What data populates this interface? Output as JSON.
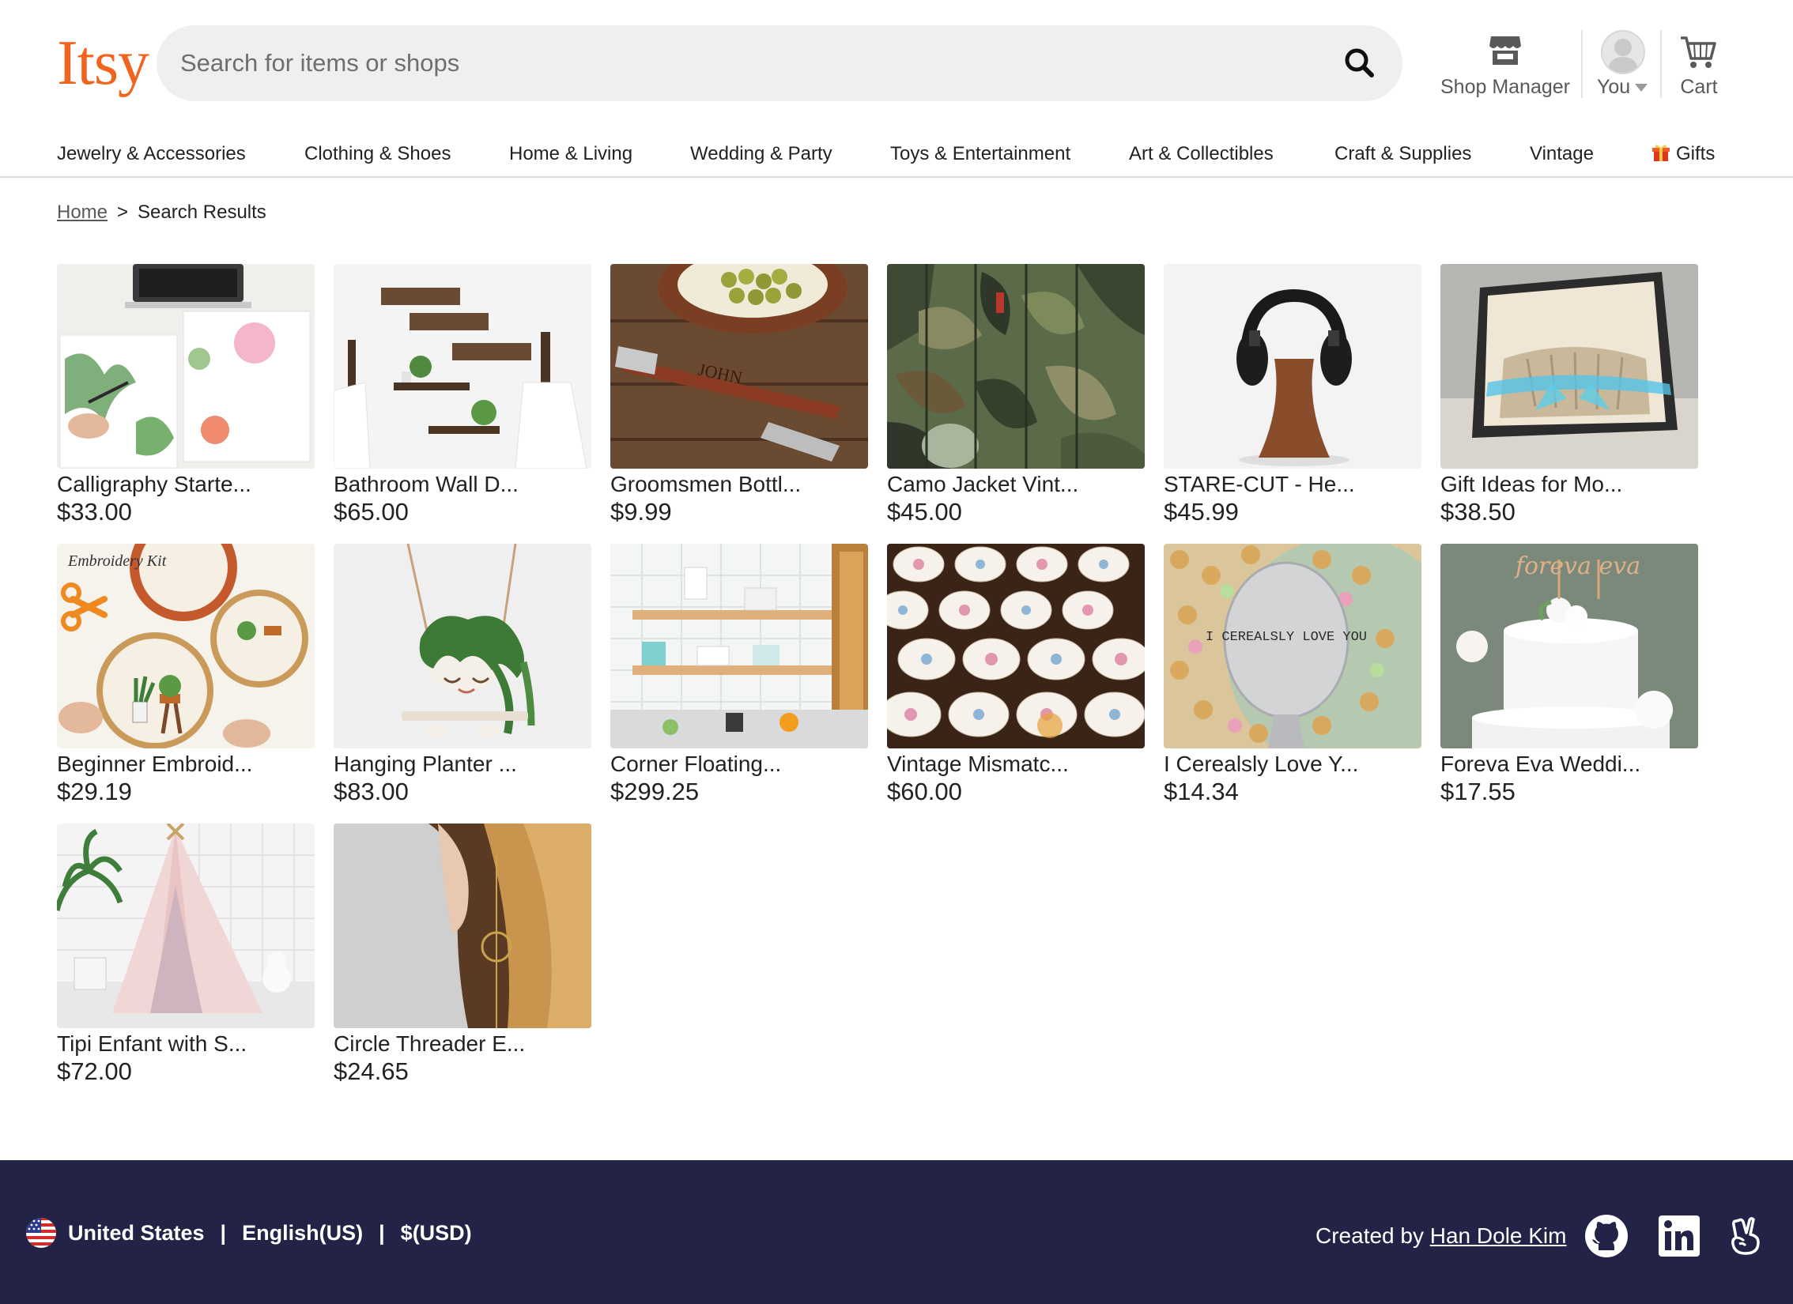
{
  "header": {
    "logo": "Itsy",
    "search_placeholder": "Search for items or shops",
    "shop_manager_label": "Shop Manager",
    "you_label": "You",
    "cart_label": "Cart"
  },
  "categories": [
    {
      "label": "Jewelry & Accessories"
    },
    {
      "label": "Clothing & Shoes"
    },
    {
      "label": "Home & Living"
    },
    {
      "label": "Wedding & Party"
    },
    {
      "label": "Toys & Entertainment"
    },
    {
      "label": "Art & Collectibles"
    },
    {
      "label": "Craft & Supplies"
    },
    {
      "label": "Vintage"
    },
    {
      "label": "Gifts",
      "icon": "gift-icon"
    }
  ],
  "breadcrumb": {
    "home": "Home",
    "separator": ">",
    "current": "Search Results"
  },
  "products": [
    {
      "title": "Calligraphy Starte...",
      "price": "$33.00",
      "image": "calligraphy-kit-image"
    },
    {
      "title": "Bathroom Wall D...",
      "price": "$65.00",
      "image": "bathroom-shelves-image"
    },
    {
      "title": "Groomsmen Bottl...",
      "price": "$9.99",
      "image": "bottle-opener-image"
    },
    {
      "title": "Camo Jacket Vint...",
      "price": "$45.00",
      "image": "camo-jackets-image"
    },
    {
      "title": "STARE-CUT - He...",
      "price": "$45.99",
      "image": "headphone-stand-image"
    },
    {
      "title": "Gift Ideas for Mo...",
      "price": "$38.50",
      "image": "folded-book-image"
    },
    {
      "title": "Beginner Embroid...",
      "price": "$29.19",
      "image": "embroidery-kit-image"
    },
    {
      "title": "Hanging Planter ...",
      "price": "$83.00",
      "image": "hanging-planter-image"
    },
    {
      "title": "Corner Floating...",
      "price": "$299.25",
      "image": "floating-shelves-image"
    },
    {
      "title": "Vintage Mismatc...",
      "price": "$60.00",
      "image": "teacups-image"
    },
    {
      "title": "I Cerealsly Love Y...",
      "price": "$14.34",
      "image": "stamped-spoon-image"
    },
    {
      "title": "Foreva Eva Weddi...",
      "price": "$17.55",
      "image": "cake-topper-image"
    },
    {
      "title": "Tipi Enfant with S...",
      "price": "$72.00",
      "image": "tipi-tent-image"
    },
    {
      "title": "Circle Threader E...",
      "price": "$24.65",
      "image": "threader-earring-image"
    }
  ],
  "image_text": {
    "embroidery": "Embroidery Kit",
    "spoon": "I CEREALSLY LOVE YOU",
    "opener": "JOHN",
    "cake": "foreva eva"
  },
  "footer": {
    "country": "United States",
    "language": "English(US)",
    "currency": "$(USD)",
    "pipe": "|",
    "credit_prefix": "Created by",
    "credit_name": "Han Dole Kim",
    "social": [
      "github-icon",
      "linkedin-icon",
      "angellist-icon"
    ]
  },
  "colors": {
    "brand": "#f1641e",
    "footer_bg": "#232347",
    "search_bg": "#efefef"
  }
}
